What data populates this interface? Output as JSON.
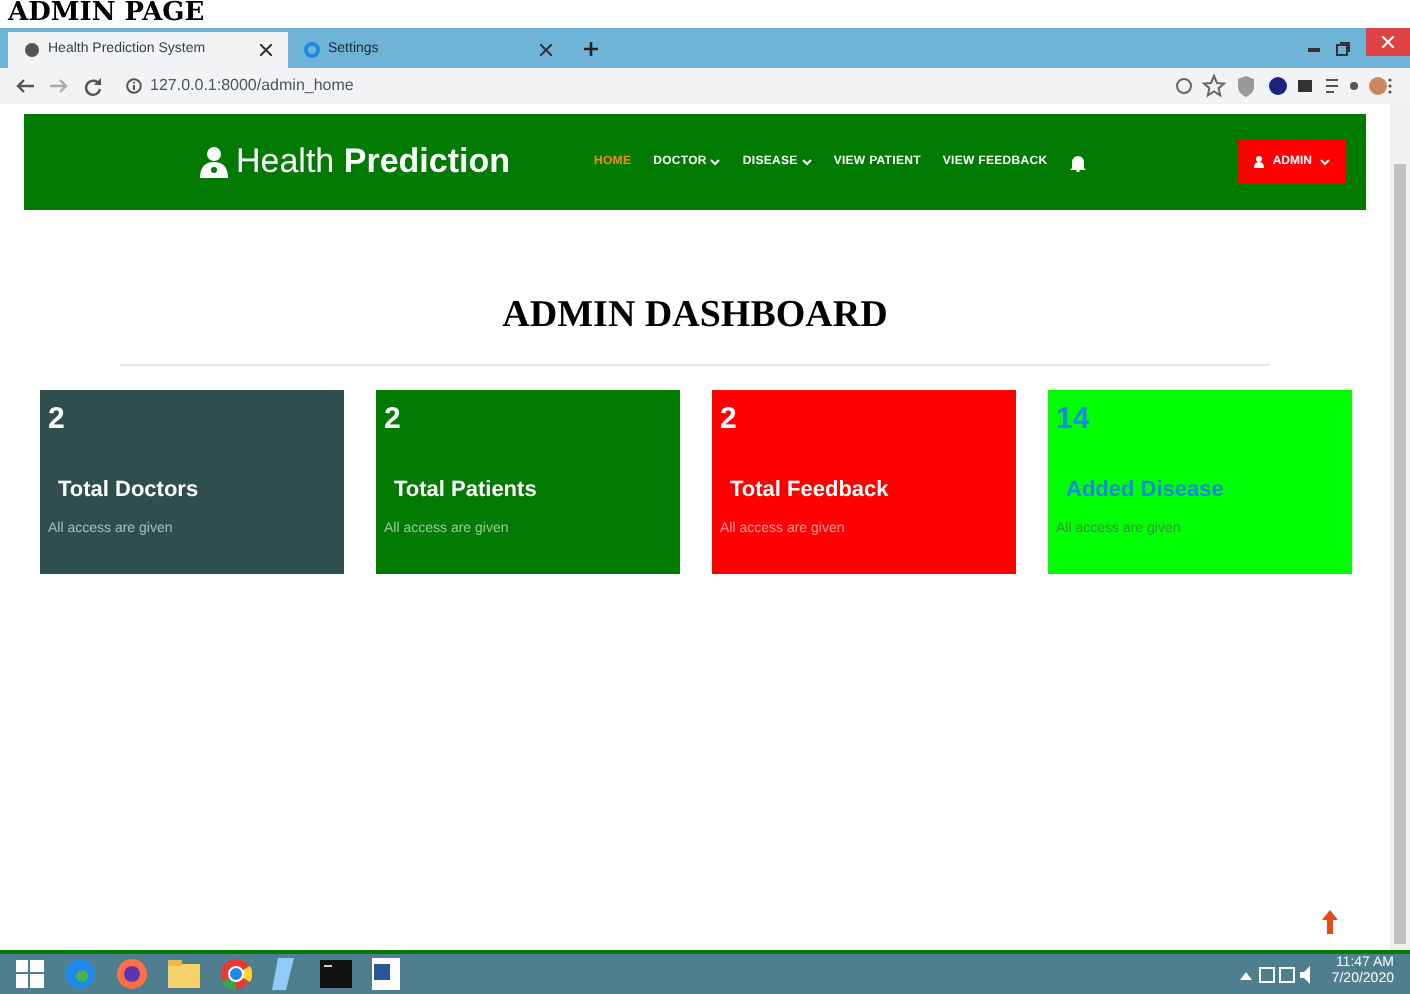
{
  "caption": "ADMIN PAGE",
  "browser": {
    "tabs": [
      {
        "label": "Health Prediction System",
        "selected": true
      },
      {
        "label": "Settings",
        "selected": false
      }
    ],
    "url": "127.0.0.1:8000/admin_home"
  },
  "navbar": {
    "brand_light": "Health",
    "brand_bold": "Prediction",
    "items": [
      {
        "label": "HOME",
        "selected": true,
        "dropdown": false
      },
      {
        "label": "DOCTOR",
        "selected": false,
        "dropdown": true
      },
      {
        "label": "DISEASE",
        "selected": false,
        "dropdown": true
      },
      {
        "label": "VIEW PATIENT",
        "selected": false,
        "dropdown": false
      },
      {
        "label": "VIEW FEEDBACK",
        "selected": false,
        "dropdown": false
      }
    ],
    "admin_button": "ADMIN"
  },
  "heading": "ADMIN DASHBOARD",
  "cards": [
    {
      "kind": "standard",
      "count": "2",
      "title": "Total Doctors",
      "note": "All access are given",
      "color": "#2f4f4f"
    },
    {
      "kind": "standard",
      "count": "2",
      "title": "Total Patients",
      "note": "All access are given",
      "color": "#007a00"
    },
    {
      "kind": "standard",
      "count": "2",
      "title": "Total Feedback",
      "note": "All access are given",
      "color": "#ff0000"
    },
    {
      "kind": "highlight",
      "count": "14",
      "title": "Added Disease",
      "note": "All access are given",
      "color": "#00ff00"
    }
  ],
  "taskbar": {
    "time": "11:47 AM",
    "date": "7/20/2020"
  }
}
